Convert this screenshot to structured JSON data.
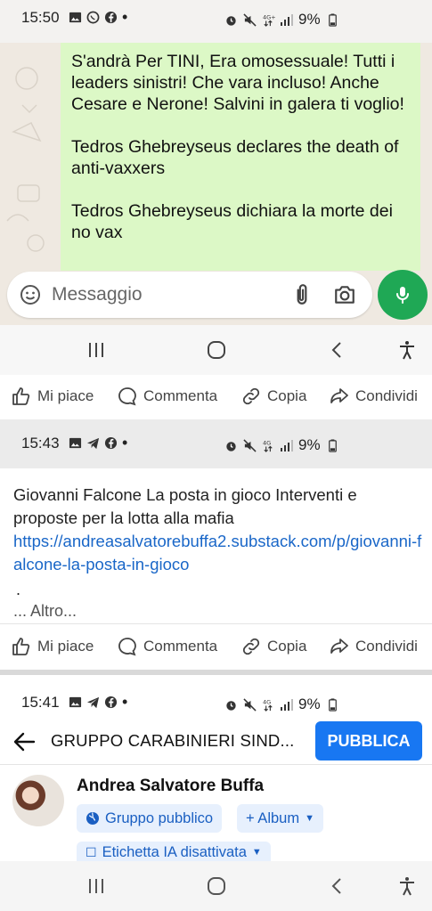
{
  "whatsapp": {
    "status": {
      "time": "15:50",
      "battery": "9%"
    },
    "message_text": "S'andrà Per TINI, Era omosessuale! Tutti i leaders sinistri! Che vara incluso! Anche Cesare e Nerone! Salvini in galera ti voglio!\n\nTedros Ghebreyseus declares the death of anti-vaxxers\n\nTedros Ghebreyseus dichiara la morte dei no vax",
    "composer_placeholder": "Messaggio",
    "accent_color": "#1fa855",
    "bubble_color": "#dcf8c6"
  },
  "actions_1": {
    "like": "Mi piace",
    "comment": "Commenta",
    "copy": "Copia",
    "share": "Condividi"
  },
  "post2": {
    "status": {
      "time": "15:43",
      "battery": "9%"
    },
    "text": "Giovanni Falcone La posta in gioco Interventi e proposte per la lotta alla mafia",
    "link": "https://andreasalvatorebuffa2.substack.com/p/giovanni-falcone-la-posta-in-gioco",
    "dot": ".",
    "more": "... Altro...",
    "link_color": "#1a67c8"
  },
  "actions_2": {
    "like": "Mi piace",
    "comment": "Commenta",
    "copy": "Copia",
    "share": "Condividi"
  },
  "post3": {
    "status": {
      "time": "15:41",
      "battery": "9%"
    },
    "group_title": "GRUPPO CARABINIERI SIND...",
    "publish_label": "PUBBLICA",
    "author": "Andrea Salvatore Buffa",
    "audience_chip": "Gruppo pubblico",
    "album_chip": "+ Album",
    "ai_label_chip": "Etichetta IA disattivata",
    "brand_color": "#1877f2"
  }
}
